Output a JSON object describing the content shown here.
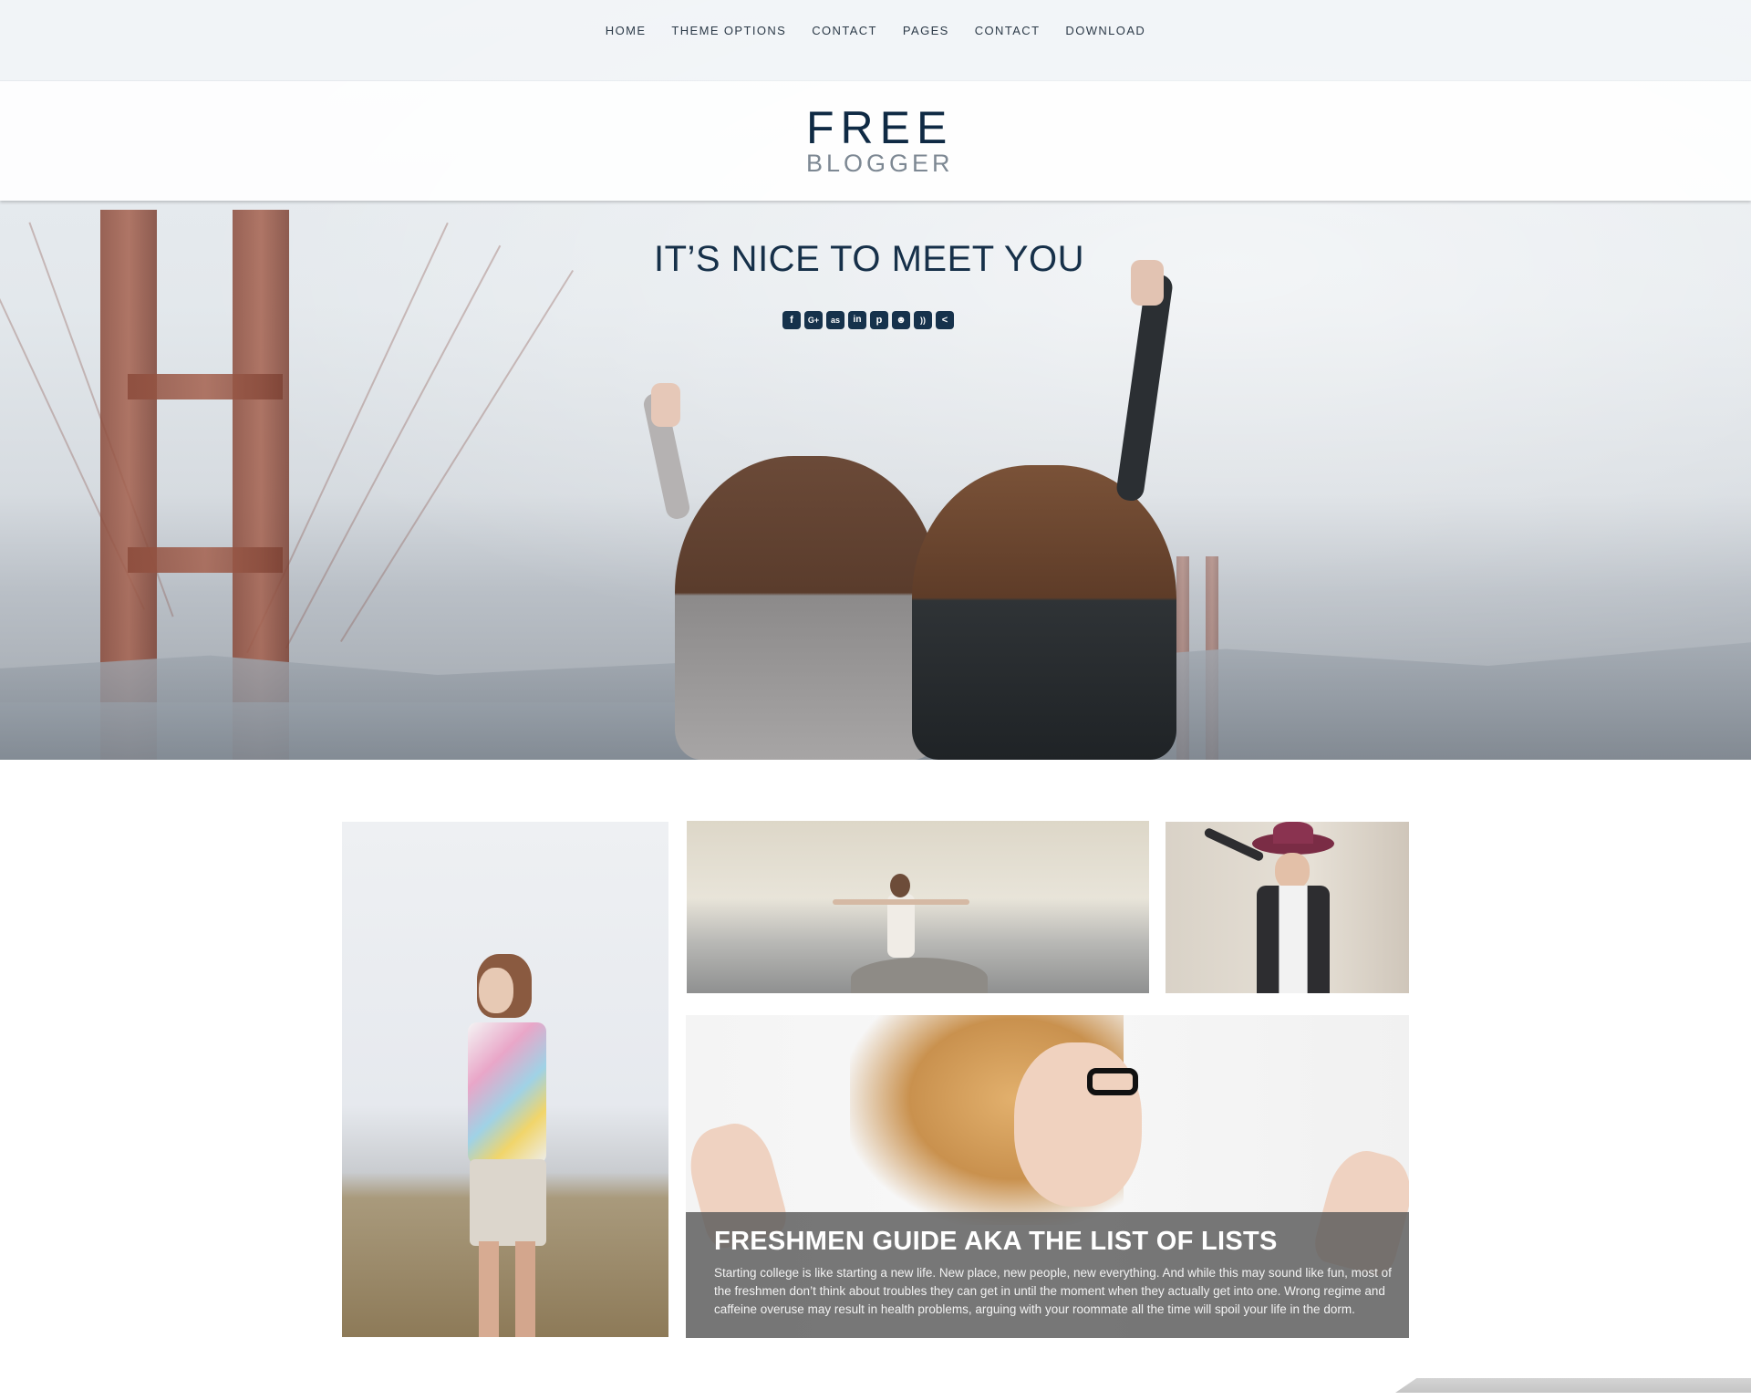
{
  "nav": {
    "items": [
      {
        "label": "HOME"
      },
      {
        "label": "THEME OPTIONS"
      },
      {
        "label": "CONTACT"
      },
      {
        "label": "PAGES"
      },
      {
        "label": "CONTACT"
      },
      {
        "label": "DOWNLOAD"
      }
    ]
  },
  "logo": {
    "line1": "FREE",
    "line2": "BLOGGER"
  },
  "hero": {
    "title": "IT’S NICE TO MEET YOU"
  },
  "social": [
    {
      "icon": "facebook-icon",
      "glyph": "f"
    },
    {
      "icon": "google-plus-icon",
      "glyph": "G+"
    },
    {
      "icon": "lastfm-icon",
      "glyph": "as"
    },
    {
      "icon": "linkedin-icon",
      "glyph": "in"
    },
    {
      "icon": "pinterest-icon",
      "glyph": "p"
    },
    {
      "icon": "reddit-icon",
      "glyph": "☻"
    },
    {
      "icon": "rss-icon",
      "glyph": "))"
    },
    {
      "icon": "share-icon",
      "glyph": "<"
    }
  ],
  "featured": {
    "title": "FRESHMEN GUIDE AKA THE LIST OF LISTS",
    "excerpt": "Starting college is like starting a new life. New place, new people, new everything. And while this may sound like fun, most of the freshmen don’t think about troubles they can get in until the moment when they actually get into one. Wrong regime and caffeine overuse may result in health problems, arguing with your roommate all the time will spoil your life in the dorm."
  },
  "colors": {
    "nav_text": "#2c3a48",
    "logo_dark": "#0f2a44",
    "logo_light": "#7d8893",
    "hero_title": "#163049",
    "social_bg": "#16324c",
    "overlay": "#5a5a5a"
  }
}
